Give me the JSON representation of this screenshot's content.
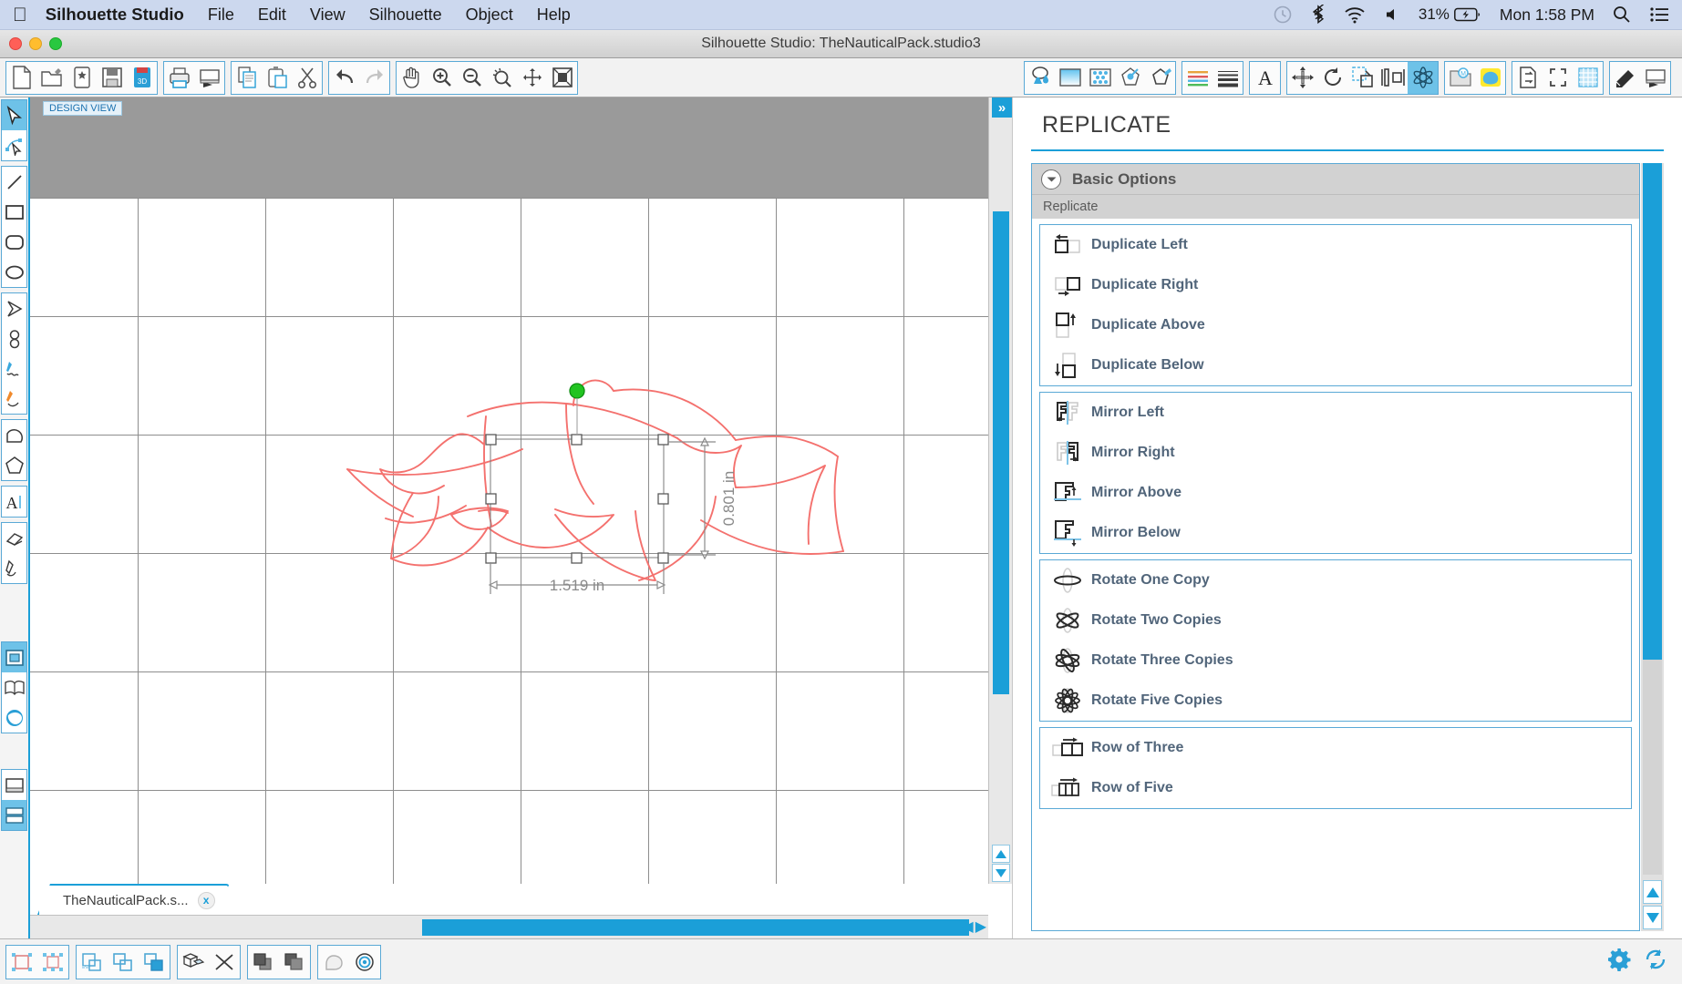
{
  "menubar": {
    "apple_icon": "apple-logo",
    "app_name": "Silhouette Studio",
    "items": [
      "File",
      "Edit",
      "View",
      "Silhouette",
      "Object",
      "Help"
    ],
    "status": {
      "timemachine_icon": "time-machine-icon",
      "bluetooth_icon": "bluetooth-icon",
      "wifi_icon": "wifi-icon",
      "volume_icon": "volume-icon",
      "battery_percent": "31%",
      "battery_icon": "battery-charging-icon",
      "clock": "Mon 1:58 PM",
      "search_icon": "search-icon",
      "controlcenter_icon": "list-menu-icon"
    }
  },
  "window": {
    "title": "Silhouette Studio: TheNauticalPack.studio3",
    "close_label": "close-button",
    "minimize_label": "minimize-button",
    "zoom_label": "maximize-button"
  },
  "toolbar": {
    "left_groups": [
      [
        "new-document",
        "open-document",
        "save-as",
        "save",
        "save-to-library"
      ],
      [
        "print",
        "send-to-silhouette"
      ],
      [
        "copy",
        "paste",
        "cut"
      ],
      [
        "undo",
        "redo"
      ],
      [
        "pan",
        "zoom-in",
        "zoom-out",
        "zoom-selection",
        "zoom-fit",
        "zoom-page"
      ]
    ],
    "right_groups": [
      [
        "fill-color",
        "fill-gradient",
        "fill-pattern",
        "transparency",
        "line-color"
      ],
      [
        "line-style",
        "line-thickness"
      ],
      [
        "text-style"
      ],
      [
        "move",
        "rotate",
        "scale",
        "align",
        "replicate"
      ],
      [
        "library",
        "store"
      ],
      [
        "page-setup",
        "registration-marks",
        "grid-settings"
      ],
      [
        "cut-settings",
        "send-panel"
      ]
    ],
    "active_tool": "replicate"
  },
  "left_tools": {
    "groups": [
      [
        "select-tool",
        "edit-points-tool"
      ],
      [
        "line-tool",
        "rectangle-tool",
        "rounded-rectangle-tool",
        "ellipse-tool"
      ],
      [
        "polygon-tool",
        "curve-tool",
        "freehand-tool",
        "smooth-freehand-tool"
      ],
      [
        "arc-tool",
        "regular-polygon-tool"
      ],
      [
        "text-tool"
      ],
      [
        "eraser-tool",
        "knife-tool"
      ],
      [
        "page-view-tool",
        "library-view-tool",
        "store-view-tool"
      ],
      [
        "cut-preview-tool",
        "send-view-tool"
      ]
    ],
    "active": "select-tool"
  },
  "canvas": {
    "design_view_label": "DESIGN VIEW",
    "document_tab": "TheNauticalPack.s...",
    "tab_close": "x",
    "selection": {
      "width_label": "1.519 in",
      "height_label": "0.801 in",
      "handle_count": 8,
      "rotate_handle_color": "#22c421",
      "artwork_stroke": "#f4716e"
    },
    "expand_button": "»",
    "scroll_left": "◀",
    "scroll_right": "▶"
  },
  "panel": {
    "title": "REPLICATE",
    "section_header": "Basic Options",
    "sub_label": "Replicate",
    "groups": [
      {
        "name": "duplicate",
        "options": [
          {
            "label": "Duplicate Left",
            "icon": "duplicate-left-icon"
          },
          {
            "label": "Duplicate Right",
            "icon": "duplicate-right-icon"
          },
          {
            "label": "Duplicate Above",
            "icon": "duplicate-above-icon"
          },
          {
            "label": "Duplicate Below",
            "icon": "duplicate-below-icon"
          }
        ]
      },
      {
        "name": "mirror",
        "options": [
          {
            "label": "Mirror Left",
            "icon": "mirror-left-icon"
          },
          {
            "label": "Mirror Right",
            "icon": "mirror-right-icon"
          },
          {
            "label": "Mirror Above",
            "icon": "mirror-above-icon"
          },
          {
            "label": "Mirror Below",
            "icon": "mirror-below-icon"
          }
        ]
      },
      {
        "name": "rotate",
        "options": [
          {
            "label": "Rotate One Copy",
            "icon": "rotate-one-copy-icon"
          },
          {
            "label": "Rotate Two Copies",
            "icon": "rotate-two-copies-icon"
          },
          {
            "label": "Rotate Three Copies",
            "icon": "rotate-three-copies-icon"
          },
          {
            "label": "Rotate Five Copies",
            "icon": "rotate-five-copies-icon"
          }
        ]
      },
      {
        "name": "row",
        "options": [
          {
            "label": "Row of Three",
            "icon": "row-of-three-icon"
          },
          {
            "label": "Row of Five",
            "icon": "row-of-five-icon"
          }
        ]
      }
    ]
  },
  "bottombar": {
    "groups": [
      [
        "group-objects",
        "ungroup-objects"
      ],
      [
        "make-compound-path",
        "release-compound-path",
        "weld"
      ],
      [
        "modify-shapes",
        "detach-lines"
      ],
      [
        "bring-to-front",
        "send-to-back"
      ],
      [
        "offset",
        "trace"
      ]
    ],
    "right": [
      "settings-gear-icon",
      "sync-icon"
    ]
  },
  "colors": {
    "accent": "#1b9fd8",
    "panel_border": "#5aa9d6",
    "menubar_bg": "#ccd8ee",
    "grid_line": "#8d8d8d",
    "artwork": "#f4716e",
    "label_text": "#51657a"
  }
}
